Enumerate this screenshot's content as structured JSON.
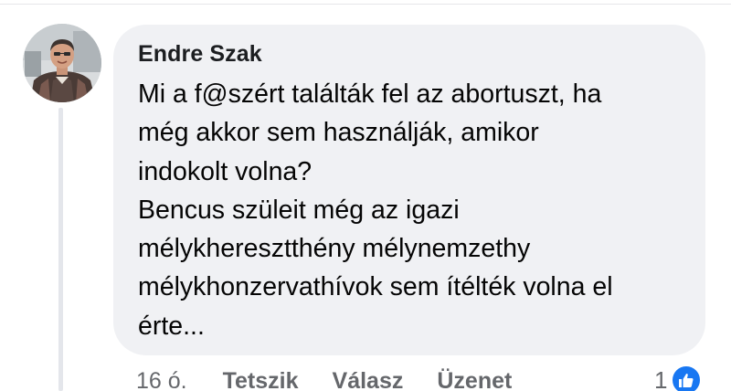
{
  "comment": {
    "author": "Endre Szak",
    "text": "Mi a f@szért találták fel az abortuszt, ha\nmég akkor sem használják, amikor\nindokolt volna?\nBencus szüleit még az igazi\nmélykheresztthény mélynemzethy\nmélykhonzervathívok sem ítélték volna el\nérte...",
    "timestamp": "16 ó.",
    "actions": {
      "like_label": "Tetszik",
      "reply_label": "Válasz",
      "message_label": "Üzenet"
    },
    "reactions": {
      "count": "1",
      "icon": "thumbs-up-icon",
      "color": "#1877f2"
    }
  },
  "colors": {
    "bubble": "#f0f1f4",
    "secondary_text": "#65676b",
    "thread_line": "#e4e6eb"
  }
}
